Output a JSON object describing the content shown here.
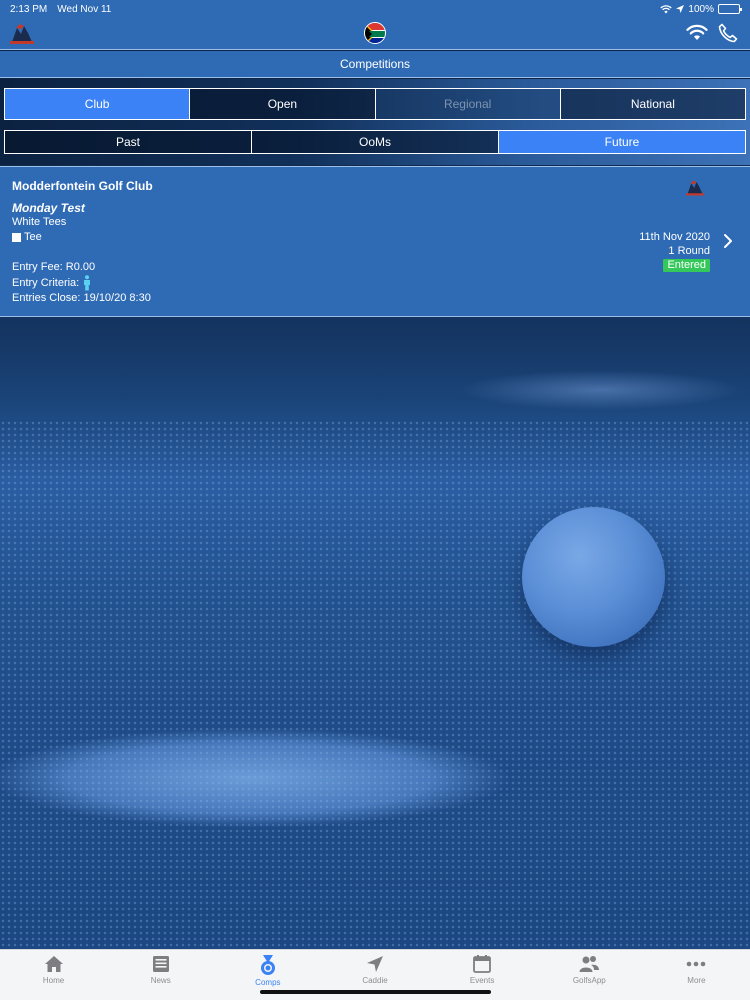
{
  "status_bar": {
    "time": "2:13 PM",
    "date": "Wed Nov 11",
    "battery": "100%"
  },
  "header": {
    "title": "Competitions"
  },
  "region_tabs": [
    {
      "label": "Club",
      "state": "active"
    },
    {
      "label": "Open",
      "state": "normal"
    },
    {
      "label": "Regional",
      "state": "disabled"
    },
    {
      "label": "National",
      "state": "normal"
    }
  ],
  "period_tabs": [
    {
      "label": "Past",
      "state": "normal"
    },
    {
      "label": "OoMs",
      "state": "normal"
    },
    {
      "label": "Future",
      "state": "active"
    }
  ],
  "competition": {
    "club": "Modderfontein Golf Club",
    "name": "Monday Test",
    "tees": "White Tees",
    "tee_label": "Tee",
    "entry_fee": "Entry Fee: R0.00",
    "entry_criteria": "Entry Criteria:",
    "entries_close": "Entries Close: 19/10/20 8:30",
    "date": "11th Nov 2020",
    "rounds": "1 Round",
    "status": "Entered"
  },
  "tab_bar": [
    {
      "label": "Home",
      "icon": "home-icon"
    },
    {
      "label": "News",
      "icon": "news-icon"
    },
    {
      "label": "Comps",
      "icon": "medal-icon",
      "active": true
    },
    {
      "label": "Caddie",
      "icon": "navigation-arrow-icon"
    },
    {
      "label": "Events",
      "icon": "calendar-icon"
    },
    {
      "label": "GolfsApp",
      "icon": "people-icon"
    },
    {
      "label": "More",
      "icon": "more-dots-icon"
    }
  ],
  "colors": {
    "bar_blue": "#2f6bb5",
    "accent": "#3b82f6",
    "entered_green": "#34c759"
  }
}
